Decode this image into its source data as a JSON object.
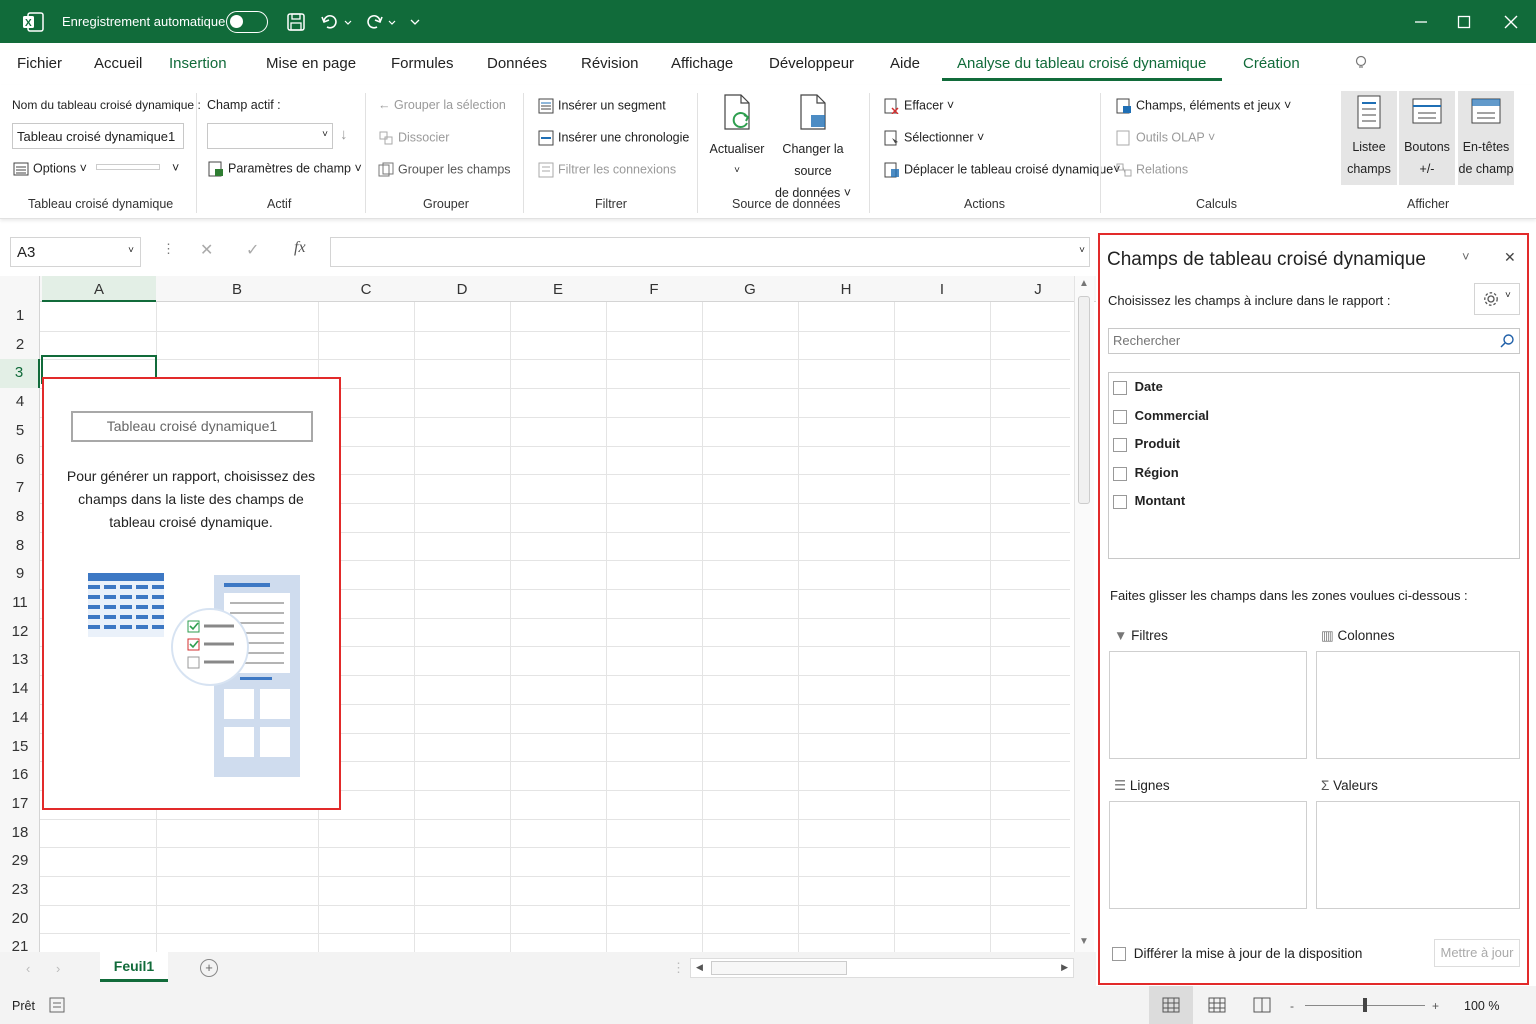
{
  "titlebar": {
    "autosave_label": "Enregistrement automatique",
    "app_icon": "excel-icon",
    "colors": {
      "bg": "#116b3a"
    }
  },
  "tabs": [
    "Fichier",
    "Accueil",
    "Insertion",
    "Mise en page",
    "Formules",
    "Données",
    "Révision",
    "Affichage",
    "Développeur",
    "Aide",
    "Analyse du tableau croisé dynamique",
    "Création"
  ],
  "active_tab": "Analyse du tableau croisé dynamique",
  "ribbon": {
    "pt_name_label": "Nom du tableau croisé dynamique :",
    "pt_name_value": "Tableau croisé dynamique1",
    "options": "Options",
    "group_pt": "Tableau croisé dynamique",
    "active_field_label": "Champ actif :",
    "field_settings": "Paramètres de champ",
    "group_active": "Actif",
    "group_selection": "Grouper la sélection",
    "ungroup": "Dissocier",
    "group_field": "Grouper les champs",
    "group_group": "Grouper",
    "insert_slicer": "Insérer un segment",
    "insert_timeline": "Insérer une chronologie",
    "filter_connections": "Filtrer les connexions",
    "group_filter": "Filtrer",
    "refresh": "Actualiser",
    "change_source_1": "Changer la source",
    "change_source_2": "de données",
    "group_data": "Source de données",
    "clear": "Effacer",
    "select": "Sélectionner",
    "move_pt": "Déplacer le tableau croisé dynamique",
    "group_actions": "Actions",
    "fields_items": "Champs, éléments et jeux",
    "olap_tools": "Outils OLAP",
    "relationships": "Relations",
    "group_calc": "Calculs",
    "field_list_1": "Listee",
    "field_list_2": "champs",
    "buttons_1": "Boutons",
    "buttons_2": "+/-",
    "headers_1": "En-têtes",
    "headers_2": "de champ",
    "group_show": "Afficher"
  },
  "formula_bar": {
    "name_box": "A3",
    "cancel": "✕",
    "enter": "✓",
    "fx": "fx"
  },
  "columns": [
    "A",
    "B",
    "C",
    "D",
    "E",
    "F",
    "G",
    "H",
    "I",
    "J"
  ],
  "rows": [
    "1",
    "2",
    "3",
    "4",
    "5",
    "6",
    "7",
    "8",
    "8",
    "9",
    "11",
    "12",
    "13",
    "14",
    "14",
    "15",
    "16",
    "17",
    "18",
    "29",
    "23",
    "20",
    "21"
  ],
  "placeholder": {
    "title": "Tableau croisé dynamique1",
    "line1": "Pour générer un rapport, choisissez des",
    "line2": "champs dans la liste des champs de",
    "line3": "tableau croisé dynamique."
  },
  "sheet_tab": "Feuil1",
  "status": {
    "ready": "Prêt",
    "zoom": "100 %",
    "zoom_level_percent": 100
  },
  "pane": {
    "title": "Champs de tableau croisé dynamique",
    "choose_label": "Choisissez les champs à inclure dans le rapport :",
    "search_placeholder": "Rechercher",
    "fields": [
      "Date",
      "Commercial",
      "Produit",
      "Région",
      "Montant"
    ],
    "drag_label": "Faites glisser les champs dans les zones voulues ci-dessous :",
    "zones": {
      "filters": "Filtres",
      "columns": "Colonnes",
      "rows": "Lignes",
      "values": "Valeurs"
    },
    "defer_label": "Différer la mise à jour de la disposition",
    "update_button": "Mettre à jour"
  }
}
